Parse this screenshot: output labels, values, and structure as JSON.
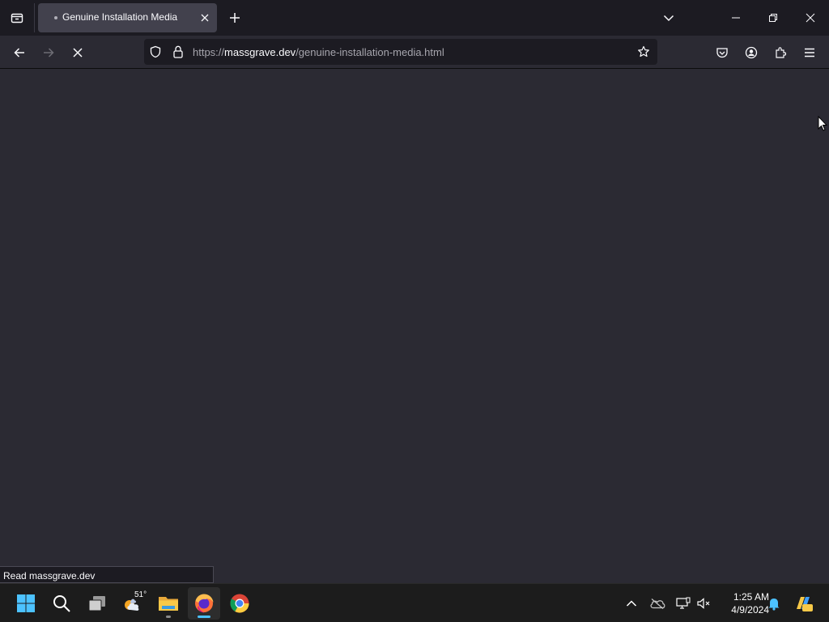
{
  "browser": {
    "tab": {
      "title": "Genuine Installation Media"
    },
    "url": {
      "scheme": "https://",
      "host": "massgrave.dev",
      "path": "/genuine-installation-media.html"
    },
    "status_text": "Read massgrave.dev"
  },
  "taskbar": {
    "weather_temp": "51°",
    "clock": {
      "time": "1:25 AM",
      "date": "4/9/2024"
    }
  },
  "icons": {
    "titlebar": [
      "tabs-list-icon",
      "close-tab-icon",
      "new-tab-icon",
      "tab-overflow-chevron-icon",
      "minimize-icon",
      "restore-icon",
      "close-window-icon"
    ],
    "navbar": [
      "back-arrow-icon",
      "forward-arrow-icon",
      "stop-loading-icon",
      "shield-icon",
      "lock-icon",
      "star-icon",
      "pocket-icon",
      "account-icon",
      "extensions-icon",
      "menu-icon"
    ],
    "taskbar": [
      "windows-start-icon",
      "search-icon",
      "task-view-icon",
      "weather-icon",
      "file-explorer-icon",
      "firefox-icon",
      "chrome-icon",
      "chevron-up-icon",
      "onedrive-icon",
      "network-icon",
      "volume-muted-icon",
      "bell-icon",
      "copilot-icon"
    ]
  },
  "colors": {
    "titlebar_bg": "#1c1b22",
    "content_bg": "#2b2a33",
    "active_tab_bg": "#42414d",
    "urlbar_bg": "#1c1b22",
    "taskbar_bg": "#1c1c1c",
    "accent": "#4cc2ff"
  }
}
